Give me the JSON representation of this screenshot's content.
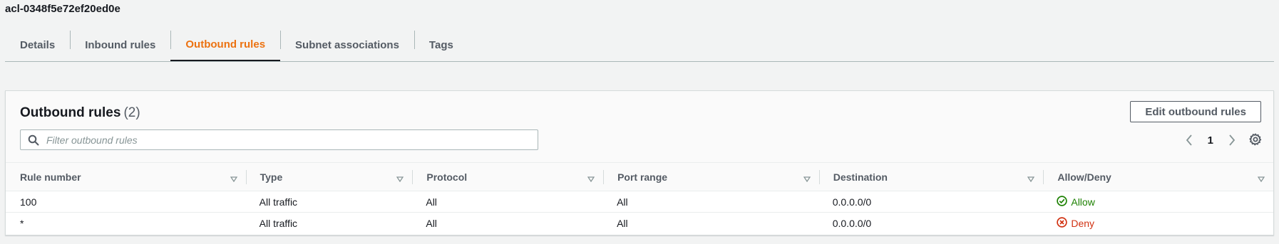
{
  "acl_id": "acl-0348f5e72ef20ed0e",
  "tabs": [
    {
      "label": "Details",
      "active": false
    },
    {
      "label": "Inbound rules",
      "active": false
    },
    {
      "label": "Outbound rules",
      "active": true
    },
    {
      "label": "Subnet associations",
      "active": false
    },
    {
      "label": "Tags",
      "active": false
    }
  ],
  "panel": {
    "title": "Outbound rules",
    "count": "(2)",
    "edit_button": "Edit outbound rules",
    "search_placeholder": "Filter outbound rules",
    "search_value": "",
    "page": "1"
  },
  "table": {
    "columns": [
      "Rule number",
      "Type",
      "Protocol",
      "Port range",
      "Destination",
      "Allow/Deny"
    ],
    "rows": [
      {
        "rule": "100",
        "type": "All traffic",
        "protocol": "All",
        "port_range": "All",
        "destination": "0.0.0.0/0",
        "action": "Allow",
        "action_status": "allow"
      },
      {
        "rule": "*",
        "type": "All traffic",
        "protocol": "All",
        "port_range": "All",
        "destination": "0.0.0.0/0",
        "action": "Deny",
        "action_status": "deny"
      }
    ]
  },
  "colors": {
    "accent": "#ec7211",
    "allow": "#1d8102",
    "deny": "#d13212",
    "text": "#16191f",
    "muted": "#545b64"
  },
  "icons": {
    "search": "search-icon",
    "prev": "chevron-left-icon",
    "next": "chevron-right-icon",
    "settings": "gear-icon",
    "sort": "sort-down-icon",
    "allow": "check-circle-icon",
    "deny": "x-circle-icon"
  }
}
